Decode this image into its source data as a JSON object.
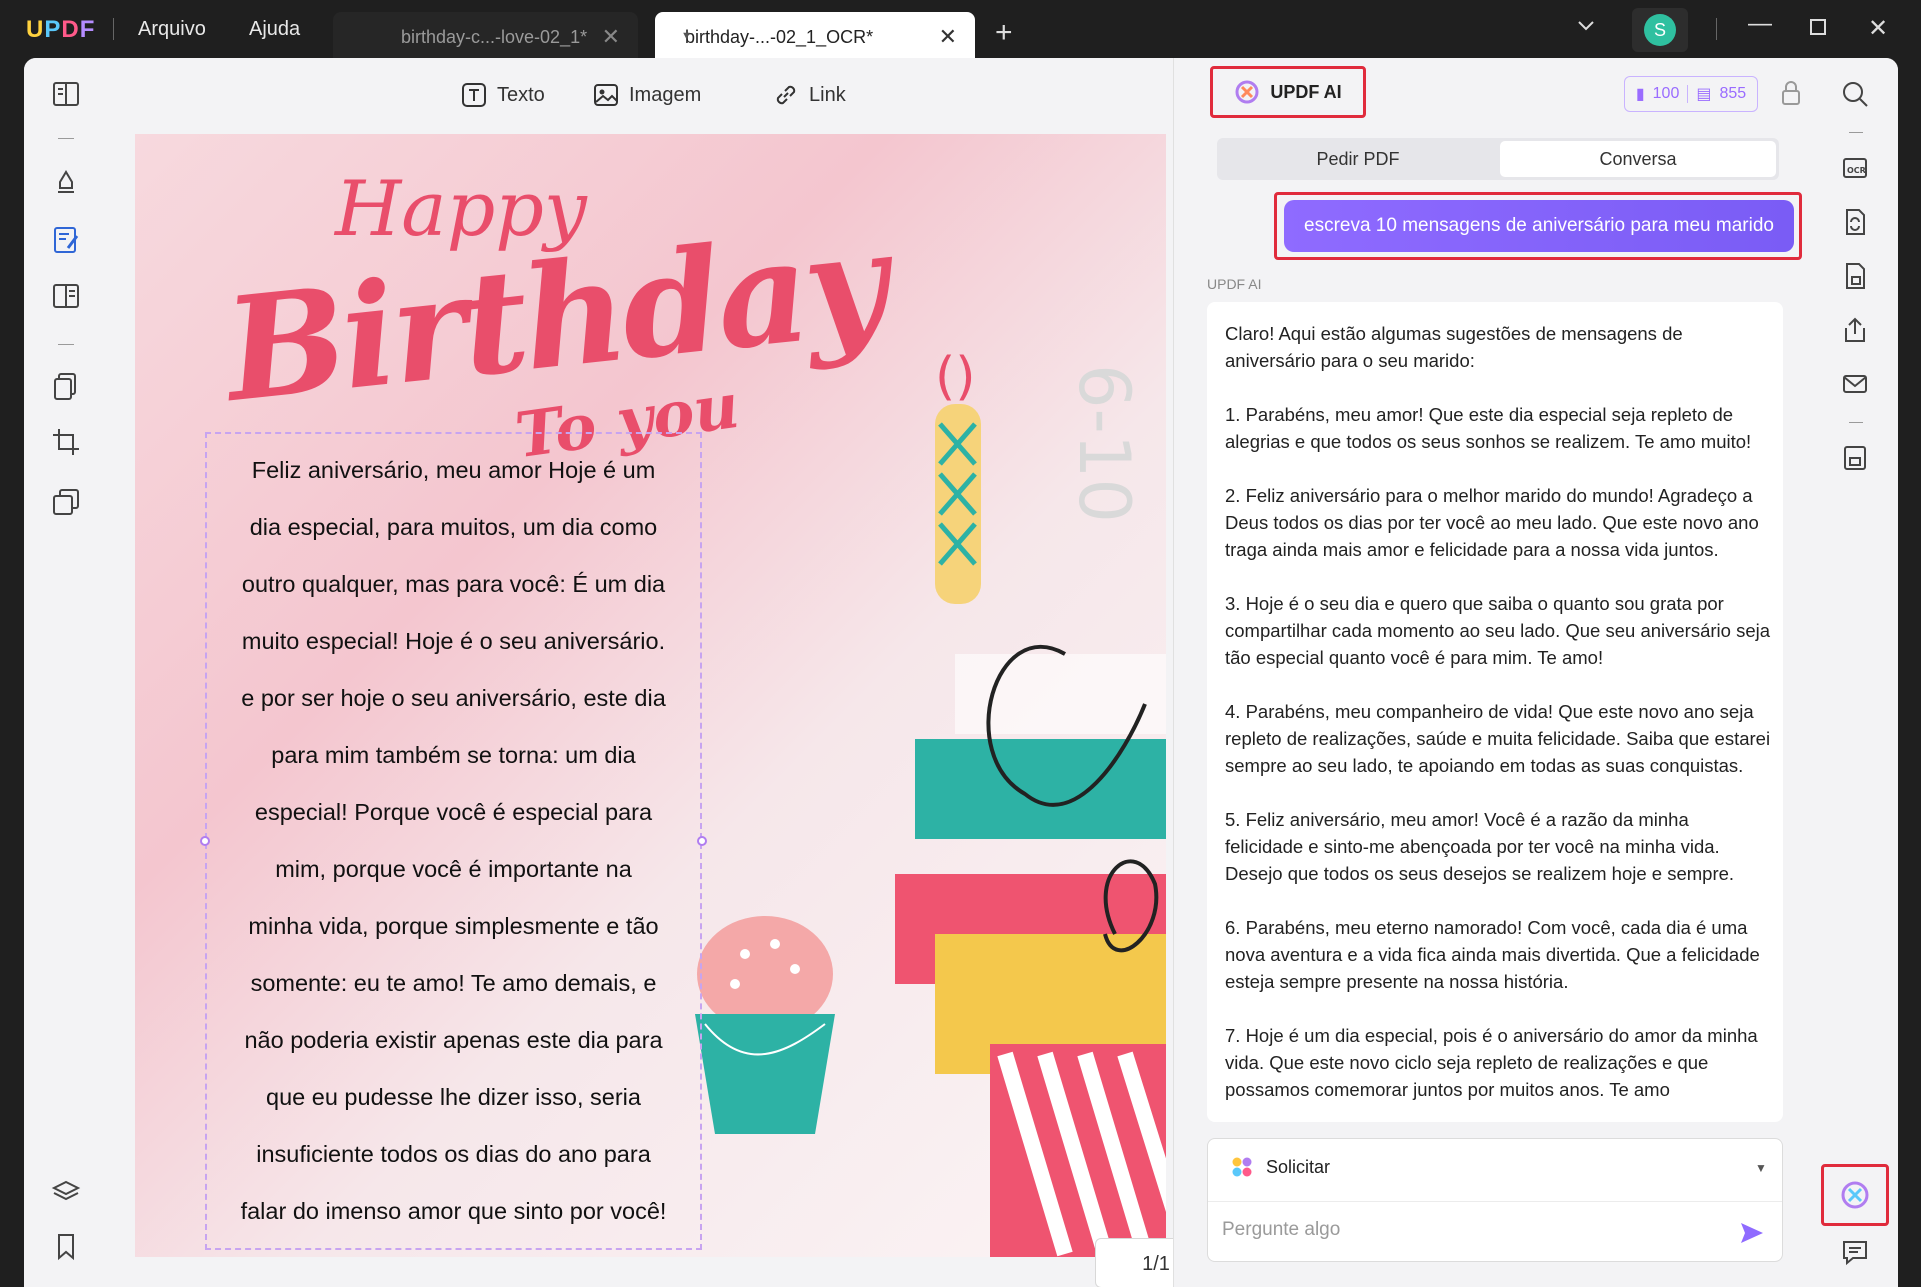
{
  "titlebar": {
    "logo": "UPDF",
    "menu": [
      "Arquivo",
      "Ajuda"
    ],
    "tabs": [
      {
        "label": "birthday-c...-love-02_1*",
        "active": false
      },
      {
        "label": "birthday-...-02_1_OCR*",
        "active": true
      }
    ],
    "avatar_letter": "S",
    "icons": [
      "chevron-down-icon",
      "minimize-icon",
      "maximize-icon",
      "close-icon"
    ]
  },
  "toolbar": {
    "text_label": "Texto",
    "image_label": "Imagem",
    "link_label": "Link"
  },
  "page": {
    "headline": [
      "Happy",
      "Birthday",
      "To you"
    ],
    "body_lines": [
      "Feliz aniversário, meu amor Hoje é um",
      "dia especial, para muitos, um dia como",
      "outro qualquer, mas para você: É um dia",
      "muito especial! Hoje é o seu aniversário.",
      "e por ser hoje o seu aniversário, este dia",
      "para mim também se torna: um dia",
      "especial! Porque você é especial para",
      "mim, porque você é importante na",
      "minha vida, porque simplesmente e tão",
      "somente: eu te amo! Te amo demais, e",
      "não poderia existir apenas este dia para",
      "que eu pudesse lhe dizer isso, seria",
      "insuficiente todos os dias do ano para",
      "falar do imenso amor que sinto por você!"
    ],
    "page_indicator": "1/1"
  },
  "ai_panel": {
    "title": "UPDF AI",
    "credits_docs": "100",
    "credits_chat": "855",
    "tabs": [
      "Pedir PDF",
      "Conversa"
    ],
    "active_tab": "Conversa",
    "user_message": "escreva 10 mensagens de aniversário para meu marido",
    "response_label": "UPDF AI",
    "response_paragraphs": [
      "Claro! Aqui estão algumas sugestões de mensagens de aniversário para o seu marido:",
      "1. Parabéns, meu amor! Que este dia especial seja repleto de alegrias e que todos os seus sonhos se realizem. Te amo muito!",
      "2. Feliz aniversário para o melhor marido do mundo! Agradeço a Deus todos os dias por ter você ao meu lado. Que este novo ano traga ainda mais amor e felicidade para a nossa vida juntos.",
      "3. Hoje é o seu dia e quero que saiba o quanto sou grata por compartilhar cada momento ao seu lado. Que seu aniversário seja tão especial quanto você é para mim. Te amo!",
      "4. Parabéns, meu companheiro de vida! Que este novo ano seja repleto de realizações, saúde e muita felicidade. Saiba que estarei sempre ao seu lado, te apoiando em todas as suas conquistas.",
      "5. Feliz aniversário, meu amor! Você é a razão da minha felicidade e sinto-me abençoada por ter você na minha vida. Desejo que todos os seus desejos se realizem hoje e sempre.",
      "6. Parabéns, meu eterno namorado! Com você, cada dia é uma nova aventura e a vida fica ainda mais divertida. Que a felicidade esteja sempre presente na nossa história.",
      "7. Hoje é um dia especial, pois é o aniversário do amor da minha vida. Que este novo ciclo seja repleto de realizações e que possamos comemorar juntos por muitos anos. Te amo"
    ],
    "prompt_selector": "Solicitar",
    "input_placeholder": "Pergunte algo"
  },
  "colors": {
    "accent_purple": "#8f6bff",
    "highlight_red": "#e02b3c",
    "headline_pink": "#e94e6b",
    "active_blue": "#2f66d6"
  }
}
